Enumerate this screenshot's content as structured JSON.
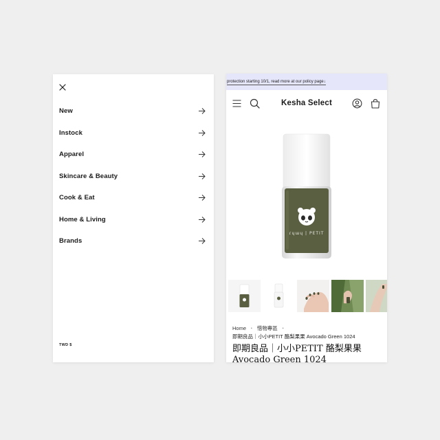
{
  "menu": {
    "items": [
      {
        "label": "New"
      },
      {
        "label": "Instock"
      },
      {
        "label": "Apparel"
      },
      {
        "label": "Skincare & Beauty"
      },
      {
        "label": "Cook & Eat"
      },
      {
        "label": "Home & Living"
      },
      {
        "label": "Brands"
      }
    ],
    "currency": "TWD $"
  },
  "product_page": {
    "announcement": "protection starting 10/1, read more at our policy page↓",
    "brand_name": "Kesha Select",
    "bottle_label_text": "ɾɥɯɥ | PETIT",
    "breadcrumb": {
      "home": "Home",
      "separator": "•",
      "category": "惜物專區",
      "trailing_separator": "•"
    },
    "product_sku": "即期良品｜小小PETIT 酪梨果果 Avocado Green 1024",
    "product_title": "即期良品｜小小PETIT 酪梨果果 Avocado Green 1024",
    "colors": {
      "announcement_bg": "#e6e6fb",
      "polish_green": "#5a5f42",
      "page_bg": "#efefef"
    }
  }
}
